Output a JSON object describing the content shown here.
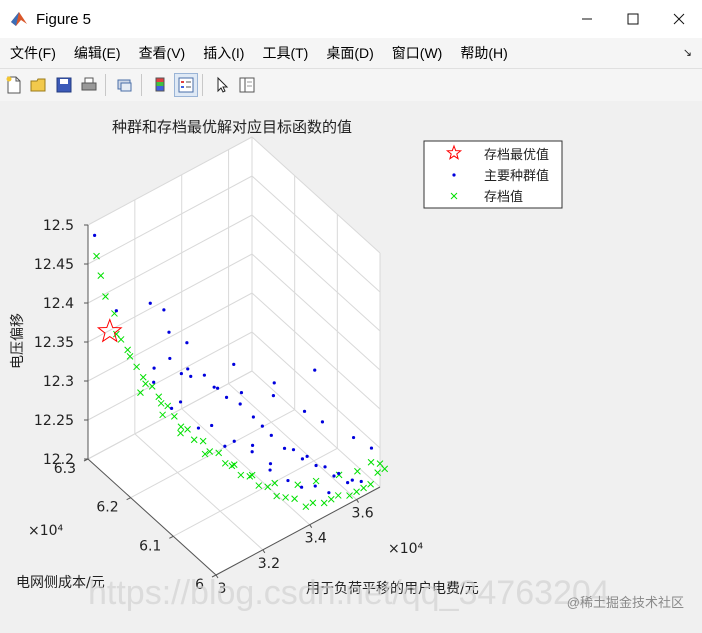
{
  "window": {
    "title": "Figure 5",
    "minimize_icon": "minimize-icon",
    "maximize_icon": "maximize-icon",
    "close_icon": "close-icon"
  },
  "menu": {
    "items": [
      "文件(F)",
      "编辑(E)",
      "查看(V)",
      "插入(I)",
      "工具(T)",
      "桌面(D)",
      "窗口(W)",
      "帮助(H)"
    ],
    "overflow_icon": "dock-arrow-icon"
  },
  "toolbar": {
    "icons": [
      "new-figure-icon",
      "open-icon",
      "save-icon",
      "print-icon",
      "link-icon",
      "colorbar-icon",
      "legend-icon",
      "pointer-icon",
      "property-editor-icon"
    ]
  },
  "chart_data": {
    "type": "scatter",
    "title": "种群和存档最优解对应目标函数的值",
    "xlabel": "用于负荷平移的用户电费/元",
    "ylabel": "电网侧成本/元",
    "zlabel": "电压偏移",
    "x_exponent": "×10⁴",
    "y_exponent": "×10⁴",
    "xlim": [
      3,
      3.7
    ],
    "ylim": [
      6.0,
      6.3
    ],
    "zlim": [
      12.2,
      12.5
    ],
    "x_ticks": [
      "3",
      "3.2",
      "3.4",
      "3.6"
    ],
    "y_ticks": [
      "6",
      "6.1",
      "6.2",
      "6.3"
    ],
    "z_ticks": [
      "12.2",
      "12.25",
      "12.3",
      "12.35",
      "12.4",
      "12.45",
      "12.5"
    ],
    "grid": true,
    "legend_position": "top-right",
    "colors": {
      "archive_best": "#ff0000",
      "population": "#0000dd",
      "archive": "#00e000"
    },
    "series": [
      {
        "name": "存档最优值",
        "marker": "star",
        "points": [
          [
            3.02,
            6.26,
            12.38
          ]
        ]
      },
      {
        "name": "主要种群值",
        "marker": "dot",
        "points": [
          [
            3.01,
            6.29,
            12.49
          ],
          [
            3.03,
            6.25,
            12.41
          ],
          [
            3.12,
            6.22,
            12.42
          ],
          [
            3.16,
            6.21,
            12.41
          ],
          [
            3.2,
            6.22,
            12.37
          ],
          [
            3.24,
            6.2,
            12.36
          ],
          [
            3.18,
            6.18,
            12.34
          ],
          [
            3.1,
            6.2,
            12.35
          ],
          [
            3.08,
            6.19,
            12.34
          ],
          [
            3.22,
            6.18,
            12.33
          ],
          [
            3.26,
            6.17,
            12.33
          ],
          [
            3.14,
            6.16,
            12.32
          ],
          [
            3.12,
            6.17,
            12.31
          ],
          [
            3.28,
            6.15,
            12.32
          ],
          [
            3.3,
            6.14,
            12.31
          ],
          [
            3.2,
            6.12,
            12.3
          ],
          [
            3.18,
            6.14,
            12.29
          ],
          [
            3.34,
            6.13,
            12.3
          ],
          [
            3.36,
            6.11,
            12.29
          ],
          [
            3.22,
            6.1,
            12.28
          ],
          [
            3.26,
            6.1,
            12.28
          ],
          [
            3.38,
            6.1,
            12.28
          ],
          [
            3.4,
            6.09,
            12.27
          ],
          [
            3.3,
            6.08,
            12.27
          ],
          [
            3.32,
            6.09,
            12.27
          ],
          [
            3.42,
            6.07,
            12.26
          ],
          [
            3.44,
            6.06,
            12.26
          ],
          [
            3.34,
            6.06,
            12.25
          ],
          [
            3.36,
            6.07,
            12.25
          ],
          [
            3.46,
            6.05,
            12.25
          ],
          [
            3.48,
            6.05,
            12.25
          ],
          [
            3.38,
            6.04,
            12.24
          ],
          [
            3.5,
            6.04,
            12.24
          ],
          [
            3.52,
            6.03,
            12.24
          ],
          [
            3.42,
            6.03,
            12.23
          ],
          [
            3.54,
            6.02,
            12.23
          ],
          [
            3.56,
            6.02,
            12.23
          ],
          [
            3.46,
            6.02,
            12.23
          ],
          [
            3.58,
            6.01,
            12.22
          ],
          [
            3.6,
            6.01,
            12.22
          ],
          [
            3.5,
            6.01,
            12.22
          ],
          [
            3.62,
            6.0,
            12.22
          ],
          [
            3.28,
            6.22,
            12.31
          ],
          [
            3.32,
            6.18,
            12.3
          ],
          [
            3.24,
            6.24,
            12.32
          ],
          [
            3.4,
            6.16,
            12.29
          ],
          [
            3.5,
            6.14,
            12.28
          ],
          [
            3.56,
            6.1,
            12.27
          ],
          [
            3.6,
            6.08,
            12.26
          ],
          [
            3.66,
            6.04,
            12.25
          ],
          [
            3.44,
            6.2,
            12.3
          ],
          [
            3.54,
            6.16,
            12.28
          ],
          [
            3.64,
            6.12,
            12.3
          ],
          [
            3.7,
            6.02,
            12.24
          ]
        ]
      },
      {
        "name": "存档值",
        "marker": "x",
        "points": [
          [
            3.0,
            6.28,
            12.47
          ],
          [
            3.0,
            6.27,
            12.45
          ],
          [
            3.02,
            6.27,
            12.42
          ],
          [
            3.04,
            6.26,
            12.4
          ],
          [
            3.03,
            6.25,
            12.38
          ],
          [
            3.05,
            6.25,
            12.37
          ],
          [
            3.06,
            6.24,
            12.36
          ],
          [
            3.07,
            6.24,
            12.35
          ],
          [
            3.08,
            6.23,
            12.34
          ],
          [
            3.09,
            6.22,
            12.33
          ],
          [
            3.1,
            6.22,
            12.32
          ],
          [
            3.11,
            6.21,
            12.32
          ],
          [
            3.12,
            6.2,
            12.31
          ],
          [
            3.13,
            6.2,
            12.3
          ],
          [
            3.14,
            6.19,
            12.3
          ],
          [
            3.15,
            6.18,
            12.29
          ],
          [
            3.16,
            6.17,
            12.28
          ],
          [
            3.17,
            6.16,
            12.28
          ],
          [
            3.18,
            6.15,
            12.27
          ],
          [
            3.2,
            6.14,
            12.27
          ],
          [
            3.21,
            6.13,
            12.26
          ],
          [
            3.23,
            6.12,
            12.26
          ],
          [
            3.24,
            6.11,
            12.25
          ],
          [
            3.26,
            6.1,
            12.25
          ],
          [
            3.27,
            6.09,
            12.24
          ],
          [
            3.29,
            6.08,
            12.24
          ],
          [
            3.31,
            6.07,
            12.23
          ],
          [
            3.33,
            6.06,
            12.23
          ],
          [
            3.35,
            6.05,
            12.22
          ],
          [
            3.37,
            6.04,
            12.22
          ],
          [
            3.39,
            6.03,
            12.22
          ],
          [
            3.42,
            6.02,
            12.21
          ],
          [
            3.45,
            6.02,
            12.21
          ],
          [
            3.48,
            6.01,
            12.21
          ],
          [
            3.51,
            6.01,
            12.21
          ],
          [
            3.54,
            6.01,
            12.21
          ],
          [
            3.57,
            6.0,
            12.21
          ],
          [
            3.6,
            6.0,
            12.21
          ],
          [
            3.63,
            6.0,
            12.21
          ],
          [
            3.66,
            6.0,
            12.21
          ],
          [
            3.69,
            6.0,
            12.22
          ],
          [
            3.7,
            6.0,
            12.23
          ],
          [
            3.68,
            6.01,
            12.23
          ],
          [
            3.64,
            6.02,
            12.22
          ],
          [
            3.58,
            6.03,
            12.22
          ],
          [
            3.5,
            6.04,
            12.22
          ],
          [
            3.44,
            6.05,
            12.22
          ],
          [
            3.36,
            6.06,
            12.23
          ],
          [
            3.3,
            6.08,
            12.24
          ],
          [
            3.25,
            6.1,
            12.25
          ],
          [
            3.19,
            6.13,
            12.26
          ],
          [
            3.14,
            6.16,
            12.28
          ],
          [
            3.1,
            6.18,
            12.3
          ],
          [
            3.06,
            6.21,
            12.32
          ],
          [
            3.72,
            6.0,
            12.22
          ]
        ]
      }
    ]
  },
  "watermark": {
    "text": "https://blog.csdn.net/qq_34763204",
    "corner": "@稀土掘金技术社区"
  }
}
